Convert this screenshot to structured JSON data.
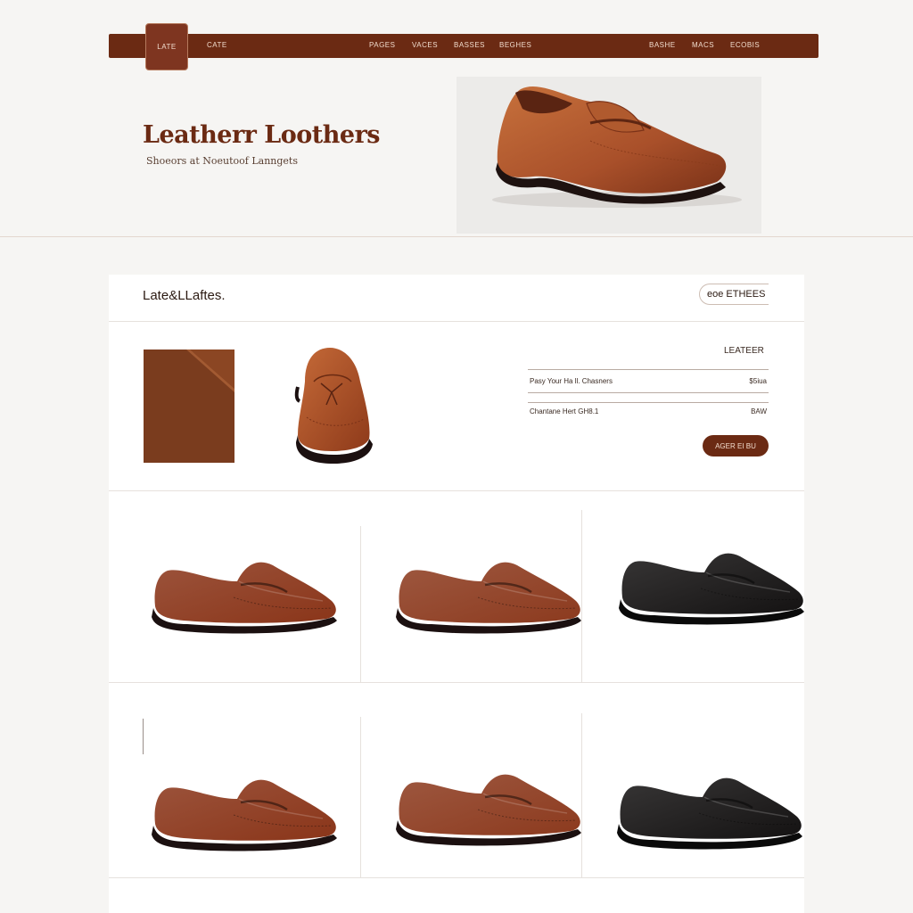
{
  "nav": {
    "logo": "LATE",
    "brand": "CATE",
    "links_center": [
      "PAGES",
      "VACES",
      "BASSES",
      "BEGHES"
    ],
    "links_right": [
      "BASHE",
      "MACS",
      "ECOBIS"
    ]
  },
  "hero": {
    "title": "Leatherr Loothers",
    "subtitle": "Shoeors at Noeutoof Lanngets"
  },
  "product": {
    "section_title": "Late&LLaftes.",
    "filter_label": "eoe ETHEES",
    "detail_label": "LEATEER",
    "specs": [
      {
        "name": "Pasy Your Ha ll. Chasners",
        "value": "$5iua"
      },
      {
        "name": "Chantane Hert GH8.1",
        "value": "BAW"
      }
    ],
    "add_button": "AGER EI BU"
  },
  "grid": {
    "items": [
      {
        "color": "#8a3519",
        "sole": "#1b1010"
      },
      {
        "color": "#8c3a1e",
        "sole": "#1b1010"
      },
      {
        "color": "#141212",
        "sole": "#0a0a0a"
      },
      {
        "color": "#8a3519",
        "sole": "#1b1010"
      },
      {
        "color": "#8c3a1e",
        "sole": "#1b1010"
      },
      {
        "color": "#141212",
        "sole": "#0a0a0a"
      }
    ]
  },
  "colors": {
    "brand": "#6b2a13",
    "hero_shoe": "#b35a2a",
    "detail_shoe": "#b5532b"
  }
}
